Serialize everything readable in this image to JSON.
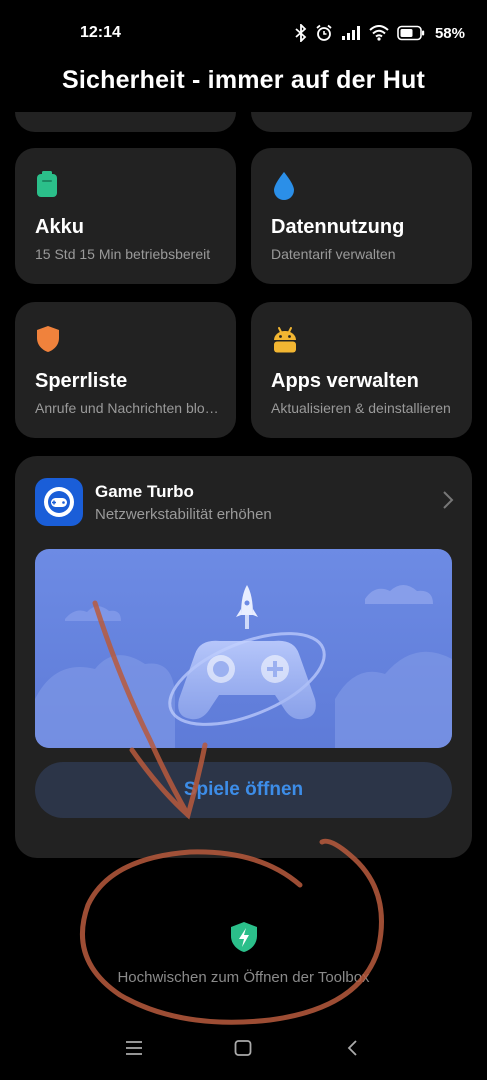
{
  "status_bar": {
    "time": "12:14",
    "battery_percent": "58%",
    "icons": [
      "bluetooth-icon",
      "alarm-icon",
      "signal-icon",
      "wifi-icon",
      "battery-icon"
    ]
  },
  "header": {
    "title": "Sicherheit - immer auf der Hut"
  },
  "tiles": [
    {
      "title": "Akku",
      "subtitle": "15 Std 15 Min betriebsbereit",
      "icon": "battery-icon",
      "color": "#2bbf8a"
    },
    {
      "title": "Datennutzung",
      "subtitle": "Datentarif verwalten",
      "icon": "droplet-icon",
      "color": "#2b8fe8"
    },
    {
      "title": "Sperrliste",
      "subtitle": "Anrufe und Nachrichten blockieren",
      "icon": "shield-icon",
      "color": "#f0823c"
    },
    {
      "title": "Apps verwalten",
      "subtitle": "Aktualisieren & deinstallieren",
      "icon": "android-icon",
      "color": "#f2b632"
    }
  ],
  "game_turbo": {
    "title": "Game Turbo",
    "subtitle": "Netzwerkstabilität erhöhen",
    "button_label": "Spiele öffnen",
    "icon": "gamepad-icon",
    "accent": "#3d8de8"
  },
  "toolbox": {
    "hint": "Hochwischen zum Öffnen der Toolbox",
    "icon": "shield-bolt-icon",
    "color": "#2bbf8a"
  },
  "nav_bar": {
    "icons": [
      "menu-icon",
      "home-icon",
      "back-icon"
    ]
  }
}
